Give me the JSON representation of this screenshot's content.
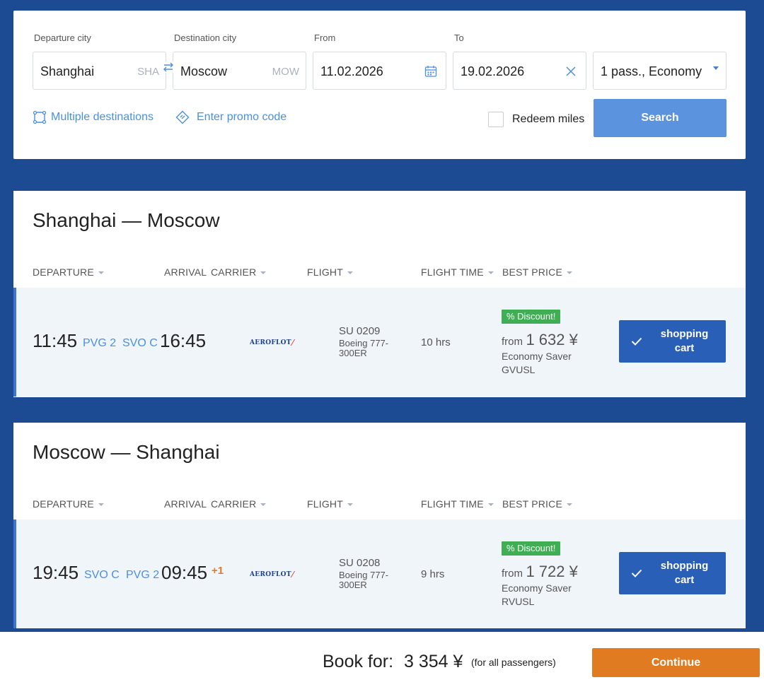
{
  "search": {
    "departure_label": "Departure city",
    "departure_value": "Shanghai",
    "departure_code": "SHA",
    "destination_label": "Destination city",
    "destination_value": "Moscow",
    "destination_code": "MOW",
    "from_label": "From",
    "from_value": "11.02.2026",
    "to_label": "To",
    "to_value": "19.02.2026",
    "passengers_value": "1 pass., Economy",
    "multiple_destinations": "Multiple destinations",
    "promo_code": "Enter promo code",
    "redeem_miles": "Redeem miles",
    "search_button": "Search"
  },
  "columns": {
    "departure": "DEPARTURE",
    "arrival": "ARRIVAL",
    "carrier": "CARRIER",
    "flight": "FLIGHT",
    "flight_time": "FLIGHT TIME",
    "best_price": "BEST PRICE"
  },
  "carrier_logo_text": "AEROFLOT",
  "routes": [
    {
      "title": "Shanghai — Moscow",
      "dep_time": "11:45",
      "dep_airport": "PVG 2",
      "arr_airport": "SVO C",
      "arr_time": "16:45",
      "plus_day": "",
      "flight_no": "SU 0209",
      "aircraft": "Boeing 777-300ER",
      "flight_time": "10 hrs",
      "discount": "% Discount!",
      "price_from": "from",
      "price": "1 632 ¥",
      "fare_name": "Economy Saver",
      "fare_code": "GVUSL",
      "cart_label": "shopping cart"
    },
    {
      "title": "Moscow — Shanghai",
      "dep_time": "19:45",
      "dep_airport": "SVO C",
      "arr_airport": "PVG 2",
      "arr_time": "09:45",
      "plus_day": "+1",
      "flight_no": "SU 0208",
      "aircraft": "Boeing 777-300ER",
      "flight_time": "9 hrs",
      "discount": "% Discount!",
      "price_from": "from",
      "price": "1 722 ¥",
      "fare_name": "Economy Saver",
      "fare_code": "RVUSL",
      "cart_label": "shopping cart"
    }
  ],
  "footer": {
    "book_label": "Book for:",
    "total": "3 354 ¥",
    "note": "(for all passengers)",
    "continue_button": "Continue"
  },
  "colors": {
    "background": "#1c4a93",
    "link": "#4a90e2",
    "search_button": "#5b93de",
    "cart_button": "#2a5fb8",
    "discount_badge": "#3fae55",
    "continue_button": "#e07b22"
  }
}
